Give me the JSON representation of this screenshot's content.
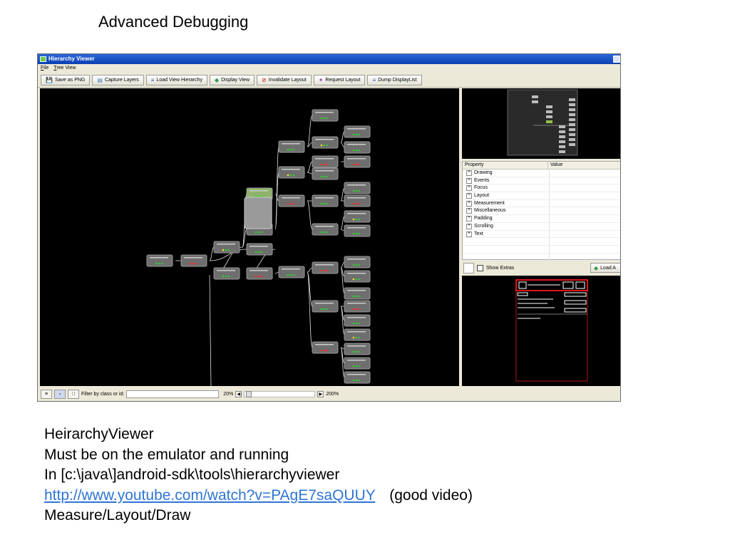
{
  "slide": {
    "title": "Advanced Debugging",
    "lines": [
      "HeirarchyViewer",
      "Must be on the emulator and running",
      "In [c:\\java\\]android-sdk\\tools\\hierarchyviewer"
    ],
    "link_text": "http://www.youtube.com/watch?v=PAgE7saQUUY",
    "link_note": "(good video)",
    "last_line": "Measure/Layout/Draw"
  },
  "window": {
    "title": "Hierarchy Viewer",
    "menu": [
      "File",
      "Tree View"
    ],
    "toolbar": [
      {
        "label": "Save as PNG",
        "icon": "save-icon"
      },
      {
        "label": "Capture Layers",
        "icon": "layers-icon"
      },
      {
        "label": "Load View Hierarchy",
        "icon": "hierarchy-icon"
      },
      {
        "label": "Display View",
        "icon": "display-icon"
      },
      {
        "label": "Invalidate Layout",
        "icon": "invalidate-icon"
      },
      {
        "label": "Request Layout",
        "icon": "request-layout-icon"
      },
      {
        "label": "Dump DisplayList",
        "icon": "dump-icon"
      }
    ],
    "properties": {
      "col_property": "Property",
      "col_value": "Value",
      "rows": [
        "Drawing",
        "Events",
        "Focus",
        "Layout",
        "Measurement",
        "Miscellaneous",
        "Padding",
        "Scrolling",
        "Text"
      ]
    },
    "show_extras": "Show Extras",
    "load_button": "Load A",
    "status": {
      "filter_label": "Filter by class or id:",
      "zoom_min": "20%",
      "zoom_max": "200%"
    }
  },
  "colors": {
    "titlebar": "#0a3fb0",
    "canvas": "#000000",
    "link": "#2e75d6",
    "node": "#6e6e6e"
  }
}
